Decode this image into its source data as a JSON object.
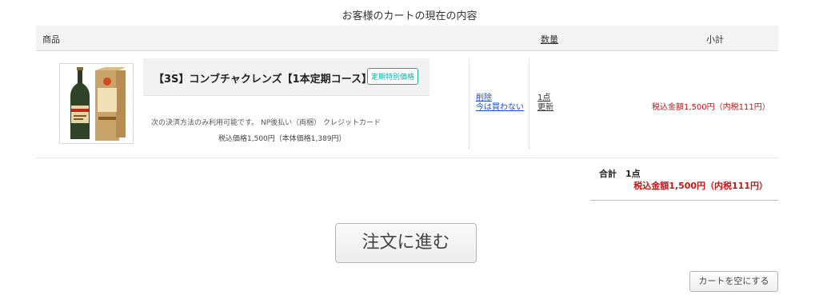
{
  "cart": {
    "title": "お客様のカートの現在の内容"
  },
  "header": {
    "product": "商品",
    "quantity": "数量",
    "subtotal": "小計"
  },
  "item": {
    "image_icon": "product-bottle-image",
    "name": "【3S】コンブチャクレンズ【1本定期コース】",
    "badge": "定期特別価格",
    "payment_note": "次の決済方法のみ利用可能です。 NP後払い（両梱） クレジットカード",
    "unit_price": "税込価格1,500円（本体価格1,389円）",
    "delete_link": "削除",
    "later_link": "今は買わない",
    "quantity": "1点",
    "update_link": "更新",
    "line_total": "税込金額1,500円（内税111円）"
  },
  "summary": {
    "label": "合計",
    "count": "1点",
    "total": "税込金額1,500円（内税111円）"
  },
  "buttons": {
    "order": "注文に進む",
    "empty_cart": "カートを空にする"
  },
  "colors": {
    "price_red": "#c41616",
    "badge_teal": "#1aa9a0",
    "link_blue": "#1a4fd6"
  }
}
